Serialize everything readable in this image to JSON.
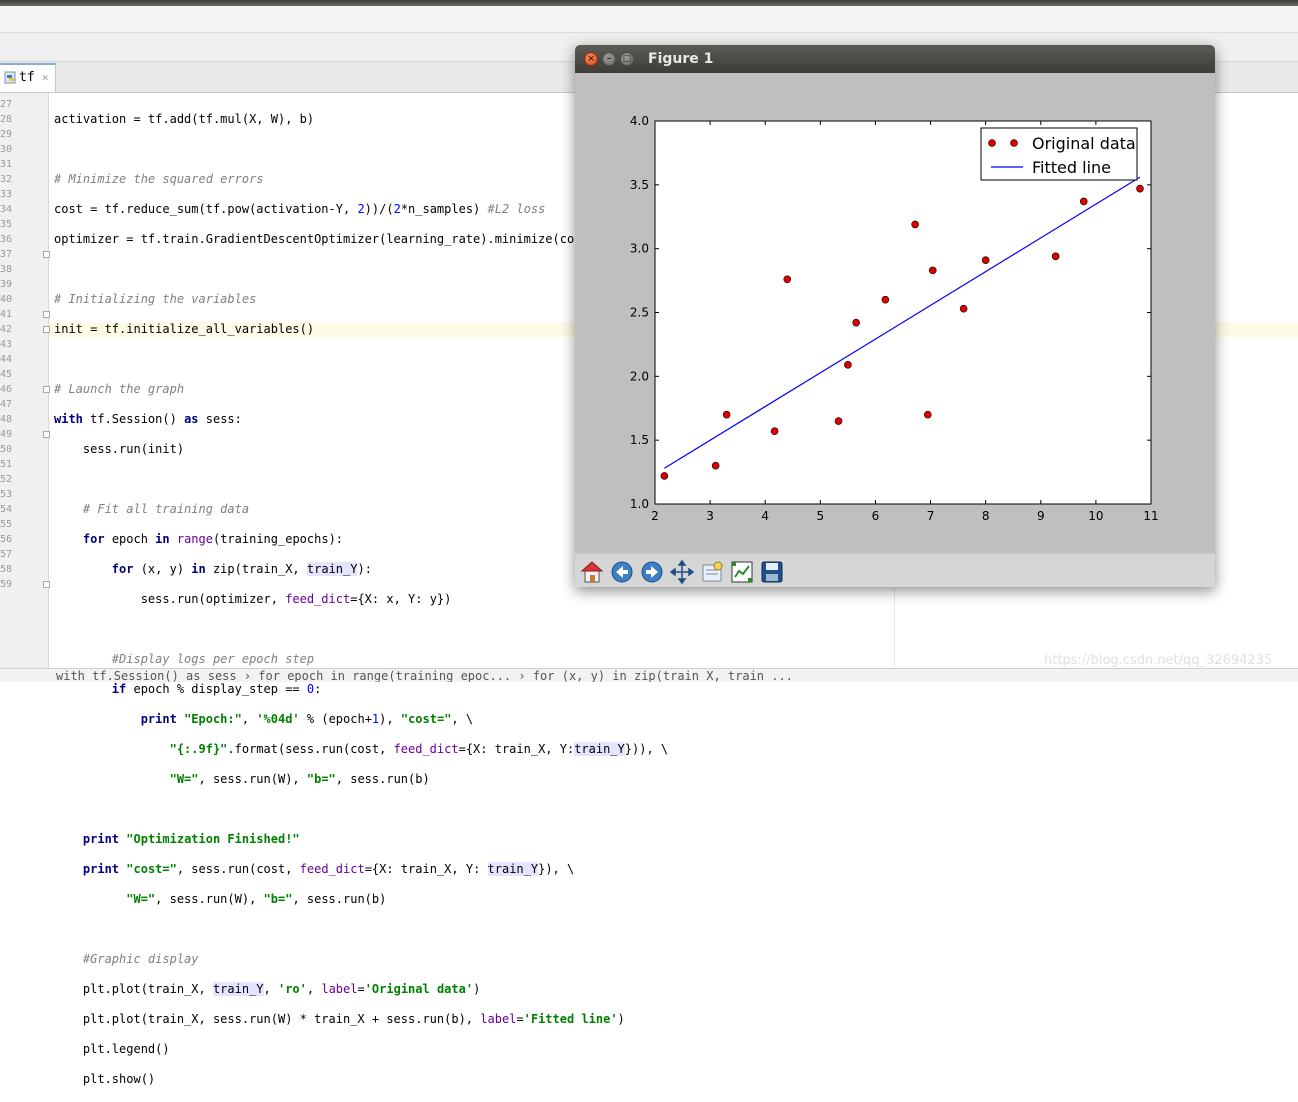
{
  "editor": {
    "tab_label": "tf",
    "tab_close": "×",
    "line_numbers": [
      "27",
      "28",
      "29",
      "30",
      "31",
      "32",
      "33",
      "34",
      "35",
      "36",
      "37",
      "38",
      "39",
      "40",
      "41",
      "42",
      "43",
      "44",
      "45",
      "46",
      "47",
      "48",
      "49",
      "50",
      "51",
      "52",
      "53",
      "54",
      "55",
      "56",
      "57",
      "58",
      "59"
    ],
    "breadcrumb": "with tf.Session() as sess  ›  for epoch in range(training_epoc...  ›  for (x, y) in zip(train_X, train_..."
  },
  "figure": {
    "window_title": "Figure 1"
  },
  "watermark": "https://blog.csdn.net/qq_32694235",
  "chart_data": {
    "type": "scatter",
    "xlim": [
      2,
      11
    ],
    "ylim": [
      1.0,
      4.0
    ],
    "x_ticks": [
      "2",
      "3",
      "4",
      "5",
      "6",
      "7",
      "8",
      "9",
      "10",
      "11"
    ],
    "y_ticks": [
      "1.0",
      "1.5",
      "2.0",
      "2.5",
      "3.0",
      "3.5",
      "4.0"
    ],
    "legend_position": "top-right",
    "grid": false,
    "series": [
      {
        "name": "Original data",
        "style": "ro",
        "color": "#e00000",
        "points": [
          [
            2.17,
            1.22
          ],
          [
            3.1,
            1.3
          ],
          [
            3.3,
            1.7
          ],
          [
            4.17,
            1.57
          ],
          [
            4.4,
            2.76
          ],
          [
            5.33,
            1.65
          ],
          [
            5.5,
            2.09
          ],
          [
            5.65,
            2.42
          ],
          [
            6.18,
            2.6
          ],
          [
            6.72,
            3.19
          ],
          [
            6.95,
            1.7
          ],
          [
            7.04,
            2.83
          ],
          [
            7.6,
            2.53
          ],
          [
            8.0,
            2.91
          ],
          [
            9.27,
            2.94
          ],
          [
            9.78,
            3.37
          ],
          [
            10.8,
            3.47
          ]
        ]
      },
      {
        "name": "Fitted line",
        "style": "line",
        "color": "#0000ff",
        "points": [
          [
            2.17,
            1.28
          ],
          [
            10.8,
            3.56
          ]
        ]
      }
    ]
  }
}
